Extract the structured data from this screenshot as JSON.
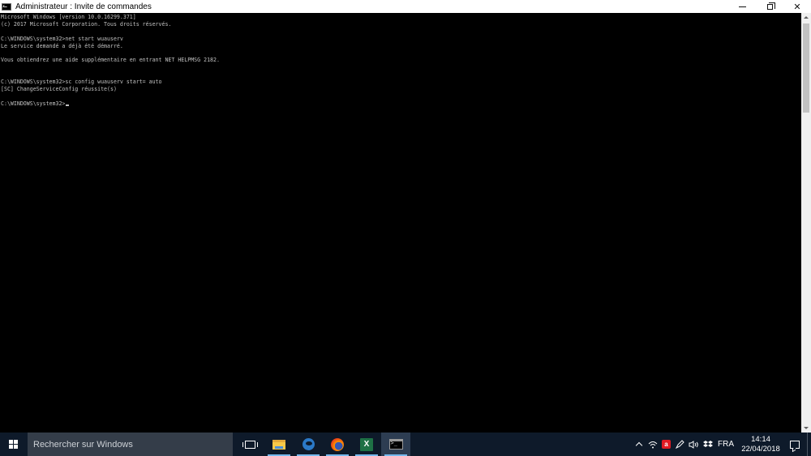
{
  "window": {
    "title": "Administrateur : Invite de commandes",
    "icon": "cmd-icon",
    "controls": [
      "minimize",
      "restore",
      "close"
    ],
    "close_glyph": "✕"
  },
  "console": {
    "lines": [
      "Microsoft Windows [version 10.0.16299.371]",
      "(c) 2017 Microsoft Corporation. Tous droits réservés.",
      "",
      "C:\\WINDOWS\\system32>net start wuauserv",
      "Le service demandé a déjà été démarré.",
      "",
      "Vous obtiendrez une aide supplémentaire en entrant NET HELPMSG 2182.",
      "",
      "",
      "C:\\WINDOWS\\system32>sc config wuauserv start= auto",
      "[SC] ChangeServiceConfig réussite(s)",
      "",
      "C:\\WINDOWS\\system32>"
    ]
  },
  "taskbar": {
    "search_placeholder": "Rechercher sur Windows",
    "apps": [
      {
        "name": "task-view",
        "icon": "task-view-icon"
      },
      {
        "name": "file-explorer",
        "icon": "folder-icon",
        "running": true
      },
      {
        "name": "edge",
        "icon": "edge-icon",
        "running": true
      },
      {
        "name": "firefox",
        "icon": "firefox-icon",
        "running": true
      },
      {
        "name": "excel",
        "icon": "excel-icon",
        "label": "X",
        "running": true
      },
      {
        "name": "command-prompt",
        "icon": "cmd-icon",
        "running": true,
        "active": true
      }
    ],
    "tray": {
      "language": "FRA",
      "time": "14:14",
      "date": "22/04/2018",
      "avira_label": "a"
    }
  },
  "colors": {
    "console_bg": "#000000",
    "console_text": "#c0c0c0",
    "taskbar_bg": "#0e1a2a",
    "search_bg": "#343d49",
    "accent": "#76b9ed"
  }
}
